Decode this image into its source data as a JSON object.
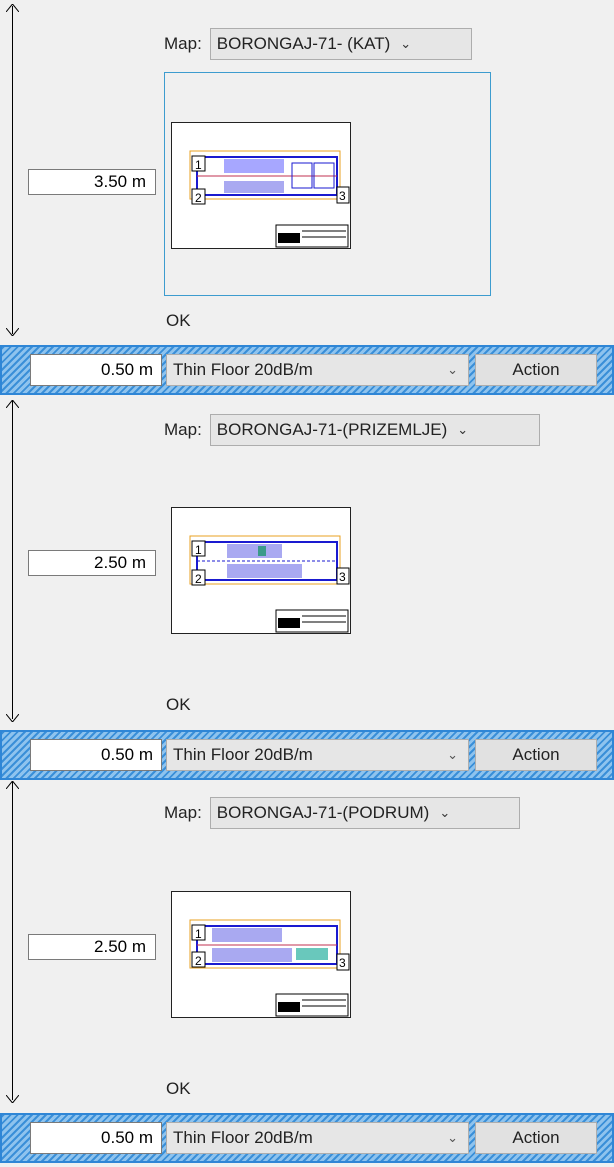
{
  "sections": [
    {
      "map_label": "Map:",
      "map_value": "BORONGAJ-71- (KAT)",
      "height": "3.50  m",
      "status": "OK",
      "floor": {
        "thickness": "0.50  m",
        "type": "Thin Floor 20dB/m",
        "action": "Action"
      }
    },
    {
      "map_label": "Map:",
      "map_value": "BORONGAJ-71-(PRIZEMLJE)",
      "height": "2.50  m",
      "status": "OK",
      "floor": {
        "thickness": "0.50  m",
        "type": "Thin Floor 20dB/m",
        "action": "Action"
      }
    },
    {
      "map_label": "Map:",
      "map_value": "BORONGAJ-71-(PODRUM)",
      "height": "2.50  m",
      "status": "OK",
      "floor": {
        "thickness": "0.50  m",
        "type": "Thin Floor 20dB/m",
        "action": "Action"
      }
    }
  ],
  "plan_labels": [
    "1",
    "2",
    "3"
  ],
  "icons": {
    "dropdown": "chevron-down-icon",
    "dimension": "dimension-arrow-icon"
  },
  "colors": {
    "band_border": "#2f86d6",
    "selection_border": "#3d9ccf",
    "plan_blue": "#1a1ad0",
    "plan_orange": "#e8a020"
  }
}
